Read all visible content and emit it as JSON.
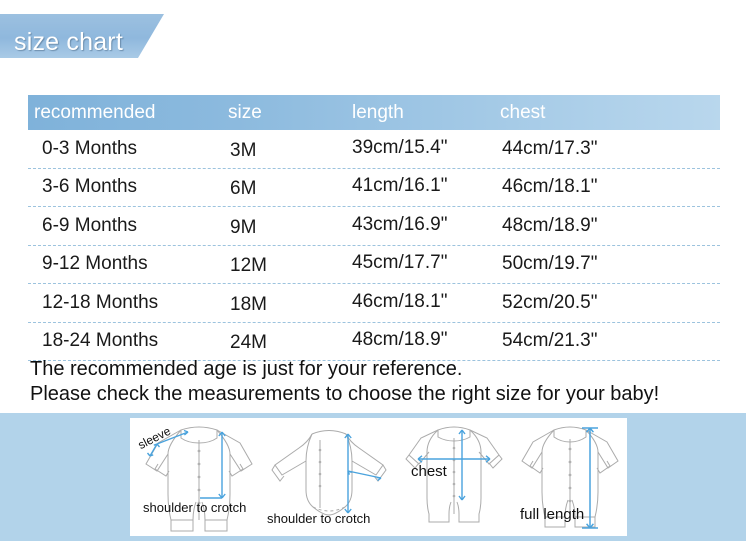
{
  "banner": {
    "title": "size chart",
    "accent_color": "#8fb8dd"
  },
  "table": {
    "headers": [
      "recommended",
      "size",
      "length",
      "chest"
    ],
    "header_gradient_from": "#7fb2da",
    "header_gradient_to": "#b9d7ed",
    "row_divider_color": "#9cc3de",
    "rows": [
      [
        "0-3 Months",
        "3M",
        "39cm/15.4\"",
        "44cm/17.3\""
      ],
      [
        "3-6 Months",
        "6M",
        "41cm/16.1\"",
        "46cm/18.1\""
      ],
      [
        "6-9 Months",
        "9M",
        "43cm/16.9\"",
        "48cm/18.9\""
      ],
      [
        "9-12 Months",
        "12M",
        "45cm/17.7\"",
        "50cm/19.7\""
      ],
      [
        "12-18 Months",
        "18M",
        "46cm/18.1\"",
        "52cm/20.5\""
      ],
      [
        "18-24 Months",
        "24M",
        "48cm/18.9\"",
        "54cm/21.3\""
      ]
    ]
  },
  "notes": [
    "The recommended age is just for your reference.",
    "Please check the measurements to choose the right size for your baby!"
  ],
  "illustrations": {
    "panel_color": "#b2d3ea",
    "arrow_color": "#4aa3dd",
    "outline_color": "#a8a8a8",
    "items": [
      {
        "garment": "long-sleeve-footed-romper",
        "labels": [
          "sleeve",
          "shoulder to crotch"
        ]
      },
      {
        "garment": "long-sleeve-bodysuit",
        "labels": [
          "shoulder to crotch"
        ]
      },
      {
        "garment": "short-sleeve-romper",
        "labels": [
          "chest"
        ]
      },
      {
        "garment": "long-sleeve-footed-romper-full",
        "labels": [
          "full length"
        ]
      }
    ]
  }
}
